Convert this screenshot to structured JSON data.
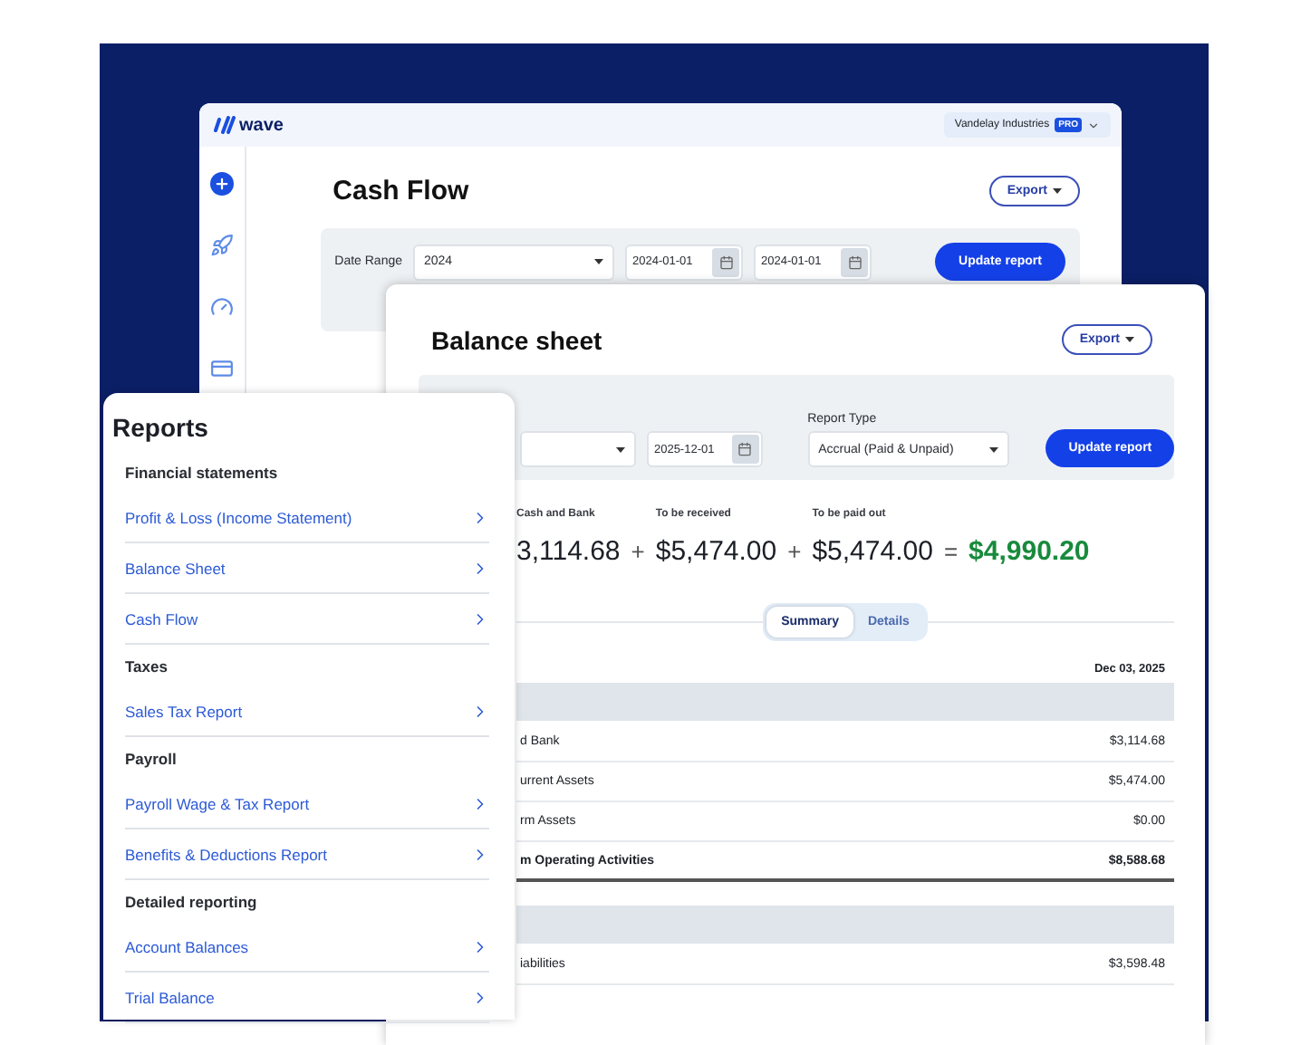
{
  "cash_flow_window": {
    "logo": "wave",
    "company": "Vandelay Industries",
    "badge": "PRO",
    "title": "Cash Flow",
    "export": "Export",
    "date_range_label": "Date Range",
    "period": "2024",
    "start_date": "2024-01-01",
    "end_date": "2024-01-01",
    "update": "Update report"
  },
  "balance_sheet": {
    "title": "Balance sheet",
    "export": "Export",
    "date": "2025-12-01",
    "report_type_label": "Report Type",
    "report_type": "Accrual (Paid & Unpaid)",
    "update": "Update report",
    "metrics": [
      {
        "label": "Cash and Bank",
        "value": "3,114.68",
        "op": "+"
      },
      {
        "label": "To be received",
        "value": "$5,474.00",
        "op": "+"
      },
      {
        "label": "To be paid out",
        "value": "$5,474.00",
        "op": "="
      }
    ],
    "net": "$4,990.20",
    "tabs": [
      {
        "label": "Summary",
        "selected": true
      },
      {
        "label": "Details",
        "selected": false
      }
    ],
    "date_header": "Dec 03, 2025",
    "rows": [
      {
        "kind": "section"
      },
      {
        "kind": "row",
        "label": "d Bank",
        "amount": "$3,114.68"
      },
      {
        "kind": "row",
        "label": "urrent Assets",
        "amount": "$5,474.00"
      },
      {
        "kind": "row",
        "label": "rm Assets",
        "amount": "$0.00"
      },
      {
        "kind": "total",
        "label": "m Operating Activities",
        "amount": "$8,588.68"
      },
      {
        "kind": "section"
      },
      {
        "kind": "row",
        "label": "iabilities",
        "amount": "$3,598.48"
      }
    ]
  },
  "reports": {
    "title": "Reports",
    "sections": [
      {
        "heading": "Financial statements",
        "items": [
          "Profit & Loss (Income Statement)",
          "Balance Sheet",
          "Cash Flow"
        ]
      },
      {
        "heading": "Taxes",
        "items": [
          "Sales Tax Report"
        ]
      },
      {
        "heading": "Payroll",
        "items": [
          "Payroll Wage & Tax Report",
          "Benefits & Deductions Report"
        ]
      },
      {
        "heading": "Detailed reporting",
        "items": [
          "Account Balances",
          "Trial Balance"
        ]
      }
    ]
  }
}
